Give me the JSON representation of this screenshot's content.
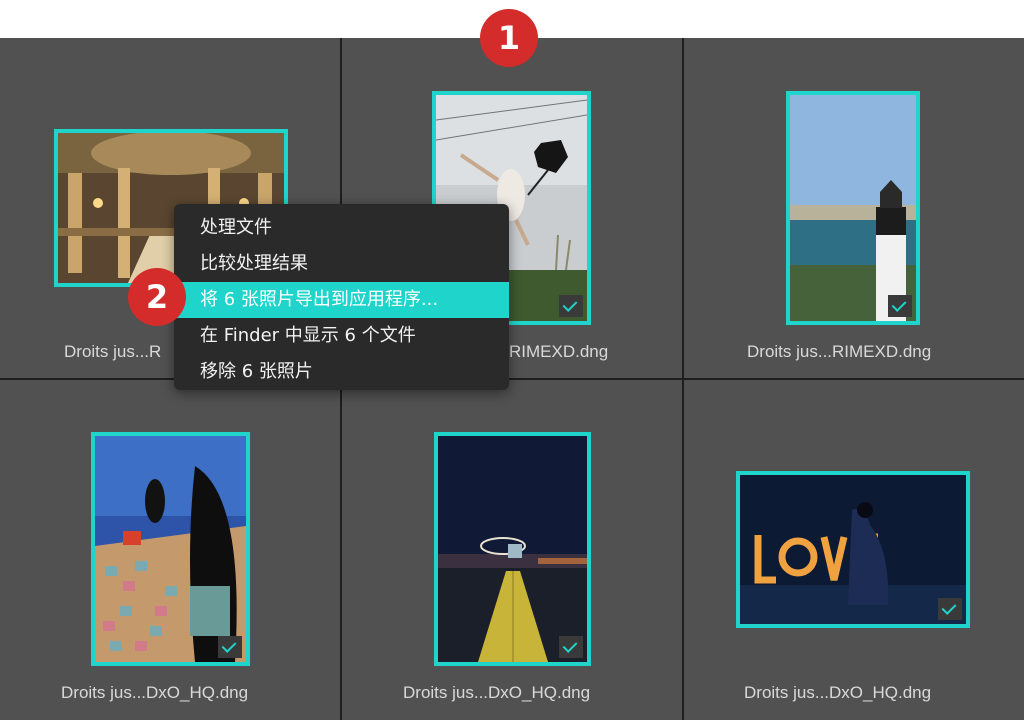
{
  "colors": {
    "accent": "#1fd5cb",
    "cell_bg": "#515151",
    "badge": "#d42b2b",
    "menu_bg": "#2a2a2a"
  },
  "badges": {
    "one": "1",
    "two": "2"
  },
  "photos": [
    {
      "caption": "Droits jus...R",
      "scene": "opera-interior",
      "checked": false
    },
    {
      "caption": "RIMEXD.dng",
      "scene": "jumping-woman",
      "checked": true
    },
    {
      "caption": "Droits jus...RIMEXD.dng",
      "scene": "lighthouse",
      "checked": true
    },
    {
      "caption": "Droits jus...DxO_HQ.dng",
      "scene": "girl-on-tiles",
      "checked": true
    },
    {
      "caption": "Droits jus...DxO_HQ.dng",
      "scene": "night-jetty",
      "checked": true
    },
    {
      "caption": "Droits jus...DxO_HQ.dng",
      "scene": "love-sign",
      "checked": true
    }
  ],
  "context_menu": {
    "items": [
      {
        "label": "处理文件"
      },
      {
        "label": "比较处理结果"
      },
      {
        "label": "将 6 张照片导出到应用程序...",
        "selected": true
      },
      {
        "label": "在 Finder 中显示 6 个文件"
      },
      {
        "label": "移除 6 张照片"
      }
    ]
  }
}
